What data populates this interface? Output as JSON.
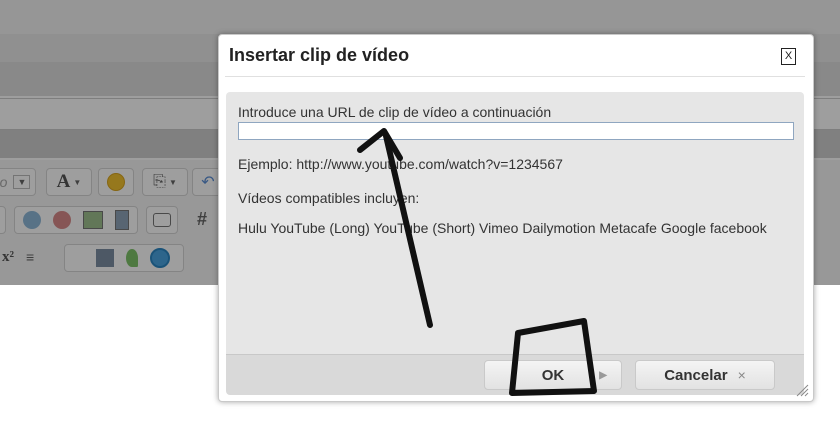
{
  "background": {
    "toolbar": {
      "icons": [
        "font-icon",
        "emoji-icon",
        "clip-icon",
        "undo-icon",
        "image-icon",
        "image-2-icon",
        "picture-icon",
        "film-icon",
        "comment-icon",
        "hash-icon",
        "superscript-icon",
        "align-icon",
        "picture-3-icon",
        "leaf-icon",
        "globe-icon"
      ],
      "font_label": "A",
      "superscript_label": "x²",
      "hash_label": "#",
      "truncated_label": "o"
    }
  },
  "dialog": {
    "title": "Insertar clip de vídeo",
    "close_label": "X",
    "url_label": "Introduce una URL de clip de vídeo a continuación",
    "url_value": "",
    "example": "Ejemplo: http://www.youtube.com/watch?v=1234567",
    "supported_label": "Vídeos compatibles incluyen:",
    "supported_list": "Hulu YouTube (Long) YouTube (Short) Vimeo Dailymotion Metacafe Google facebook",
    "ok_label": "OK",
    "cancel_label": "Cancelar",
    "cancel_icon": "×"
  },
  "colors": {
    "dialog_body": "#e6e6e6",
    "annotation": "#111111"
  }
}
